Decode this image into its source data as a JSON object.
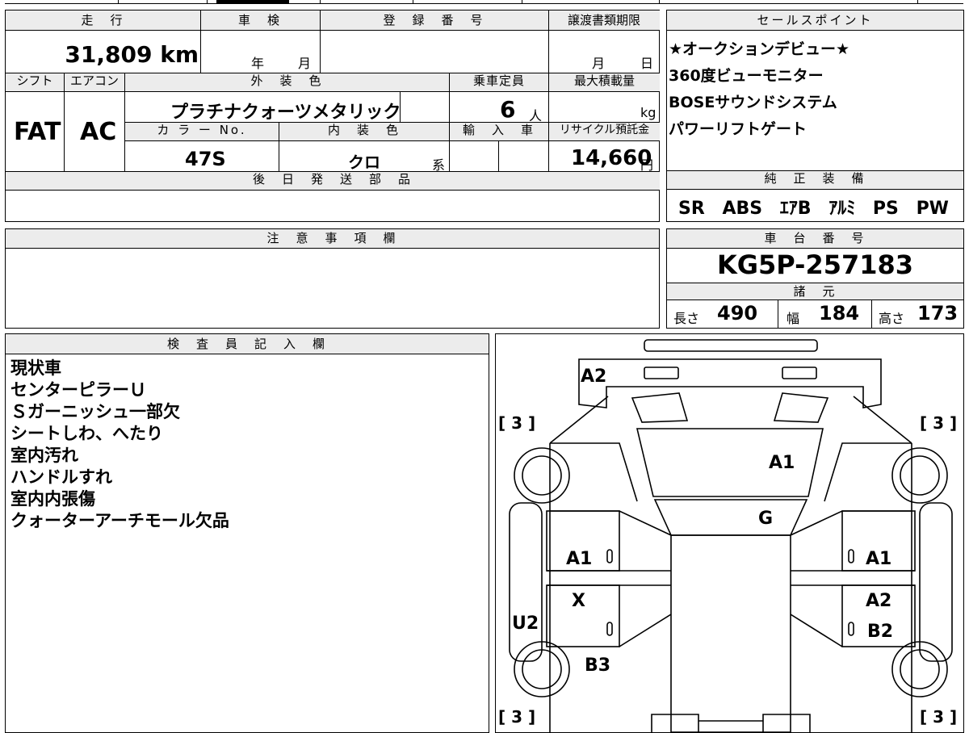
{
  "top": {
    "mileage_header": "走　行",
    "mileage": "31,809 km",
    "inspection_header": "車　検",
    "inspection_year": "年",
    "inspection_month": "月",
    "registration_header": "登　録　番　号",
    "transfer_header": "譲渡書類期限",
    "transfer_month": "月",
    "transfer_day": "日",
    "shift_header": "シフト",
    "shift": "FAT",
    "ac_header": "エアコン",
    "ac": "AC",
    "exterior_color_header": "外　装　色",
    "exterior_color": "プラチナクォーツメタリック",
    "capacity_header": "乗車定員",
    "capacity": "6",
    "capacity_unit": "人",
    "max_load_header": "最大積載量",
    "max_load_unit": "kg",
    "color_no_header": "カ ラ ー No.",
    "color_no": "47S",
    "interior_color_header": "内　装　色",
    "interior_color": "クロ",
    "interior_color_suffix": "系",
    "import_header": "輸　入　車",
    "recycle_header": "リサイクル預託金",
    "recycle_fee": "14,660",
    "recycle_unit": "円",
    "later_parts_header": "後　日　発　送　部　品"
  },
  "sales": {
    "header": "セールスポイント",
    "points": [
      "★オークションデビュー★",
      "360度ビューモニター",
      "BOSEサウンドシステム",
      "パワーリフトゲート"
    ]
  },
  "equipment": {
    "header": "純　正　装　備",
    "items": [
      "SR",
      "ABS",
      "ｴｱB",
      "ｱﾙﾐ",
      "PS",
      "PW"
    ]
  },
  "notes": {
    "header": "注　意　事　項　欄"
  },
  "chassis": {
    "header": "車　台　番　号",
    "number": "KG5P-257183"
  },
  "specs": {
    "header": "諸　元",
    "length_label": "長さ",
    "length": "490",
    "width_label": "幅",
    "width": "184",
    "height_label": "高さ",
    "height": "173"
  },
  "inspector": {
    "header": "検　査　員　記　入　欄",
    "lines": [
      "現状車",
      "センターピラーＵ",
      "Ｓガーニッシュ一部欠",
      "シートしわ、へたり",
      "室内汚れ",
      "ハンドルすれ",
      "室内内張傷",
      "クォーターアーチモール欠品"
    ]
  },
  "diagram": {
    "tire_tl": "[ 3 ]",
    "tire_tr": "[ 3 ]",
    "tire_bl": "[ 3 ]",
    "tire_br": "[ 3 ]",
    "front_bumper": "A2",
    "hood": "A1",
    "windshield": "G",
    "left_front_door": "A1",
    "left_rear_door": "X",
    "left_rocker": "U2",
    "left_rear_quarter": "B3",
    "right_front_door": "A1",
    "right_rear_door": "A2",
    "right_rear_quarter": "B2",
    "pillar_mark": "0"
  }
}
